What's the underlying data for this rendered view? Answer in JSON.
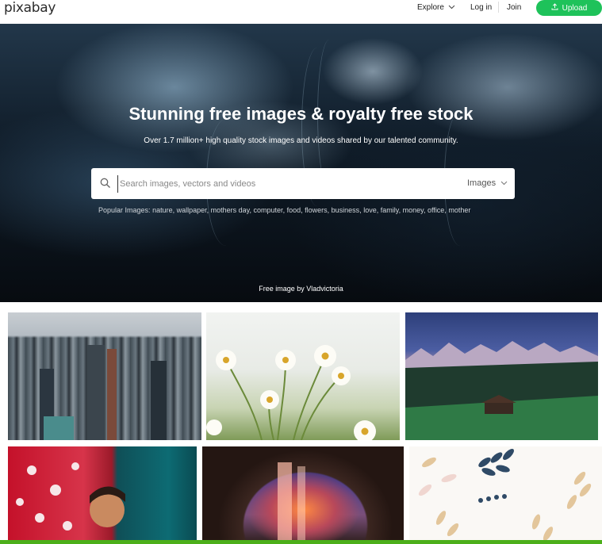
{
  "brand": {
    "logo_text": "pixabay",
    "accent_color": "#1ec25a"
  },
  "nav": {
    "explore": "Explore",
    "login": "Log in",
    "join": "Join",
    "upload": "Upload"
  },
  "hero": {
    "title": "Stunning free images & royalty free stock",
    "subtitle": "Over 1.7 million+ high quality stock images and videos shared by our talented community.",
    "search_placeholder": "Search images, vectors and videos",
    "search_value": "",
    "media_type": "Images",
    "popular_label": "Popular Images:",
    "popular_terms": [
      "nature",
      "wallpaper",
      "mothers day",
      "computer",
      "food",
      "flowers",
      "business",
      "love",
      "family",
      "money",
      "office",
      "mother"
    ],
    "credit": "Free image by Vladvictoria"
  },
  "gallery": {
    "tiles": [
      {
        "subject": "city skyline"
      },
      {
        "subject": "daisies"
      },
      {
        "subject": "mountain cabin at dusk"
      },
      {
        "subject": "child in red"
      },
      {
        "subject": "waterfall through cave arch"
      },
      {
        "subject": "botanical leaf illustration"
      }
    ]
  }
}
